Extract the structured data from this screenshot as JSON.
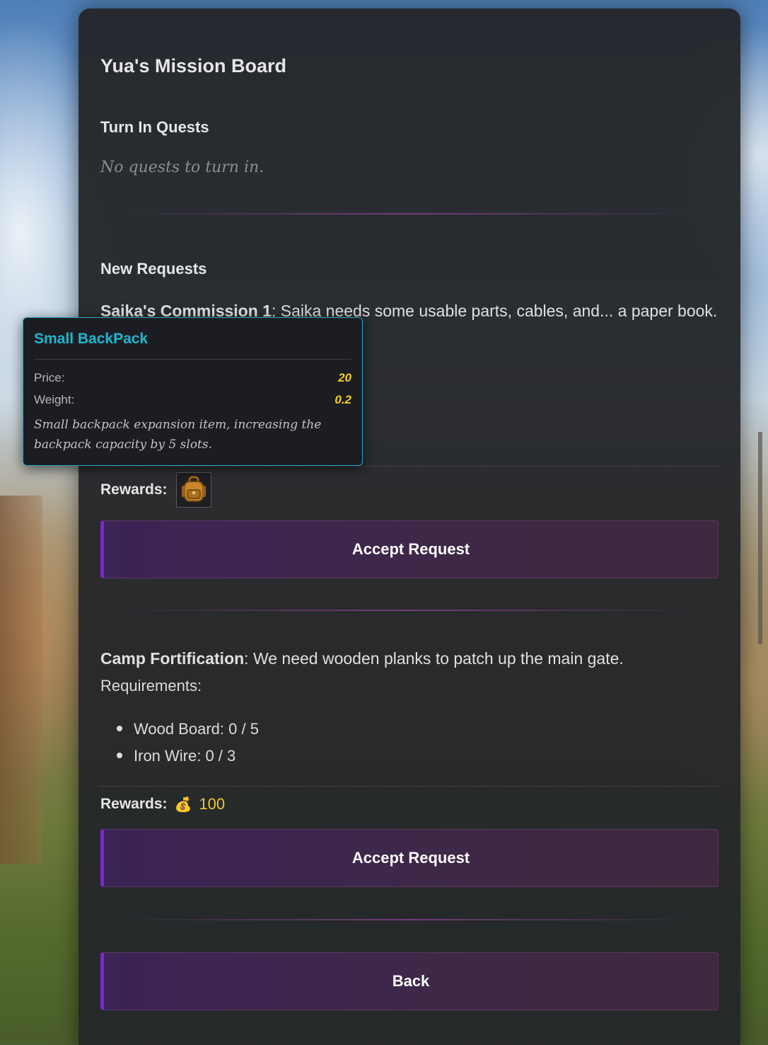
{
  "board": {
    "title": "Yua's Mission Board",
    "turn_in_heading": "Turn In Quests",
    "turn_in_empty": "No quests to turn in.",
    "new_requests_heading": "New Requests"
  },
  "quests": [
    {
      "name": "Saika's Commission 1",
      "description": ": Saika needs some usable parts, cables, and... a paper book.",
      "rewards_label": "Rewards:",
      "reward_item_icon": "backpack-icon",
      "accept_label": "Accept Request"
    },
    {
      "name": "Camp Fortification",
      "description": ": We need wooden planks to patch up the main gate.",
      "requirements_label": "Requirements:",
      "requirements": [
        "Wood Board: 0 / 5",
        "Iron Wire: 0 / 3"
      ],
      "rewards_label": "Rewards:",
      "reward_coin_icon": "💰",
      "reward_coins": "100",
      "accept_label": "Accept Request"
    }
  ],
  "back_label": "Back",
  "tooltip": {
    "title": "Small BackPack",
    "price_label": "Price:",
    "price_value": "20",
    "weight_label": "Weight:",
    "weight_value": "0.2",
    "description": "Small backpack expansion item, increasing the backpack capacity by 5 slots."
  },
  "colors": {
    "accent_purple": "#7b26d6",
    "tooltip_title": "#1fb6d0",
    "tooltip_border": "#2aa7c2",
    "value_gold": "#f5cf1c"
  }
}
